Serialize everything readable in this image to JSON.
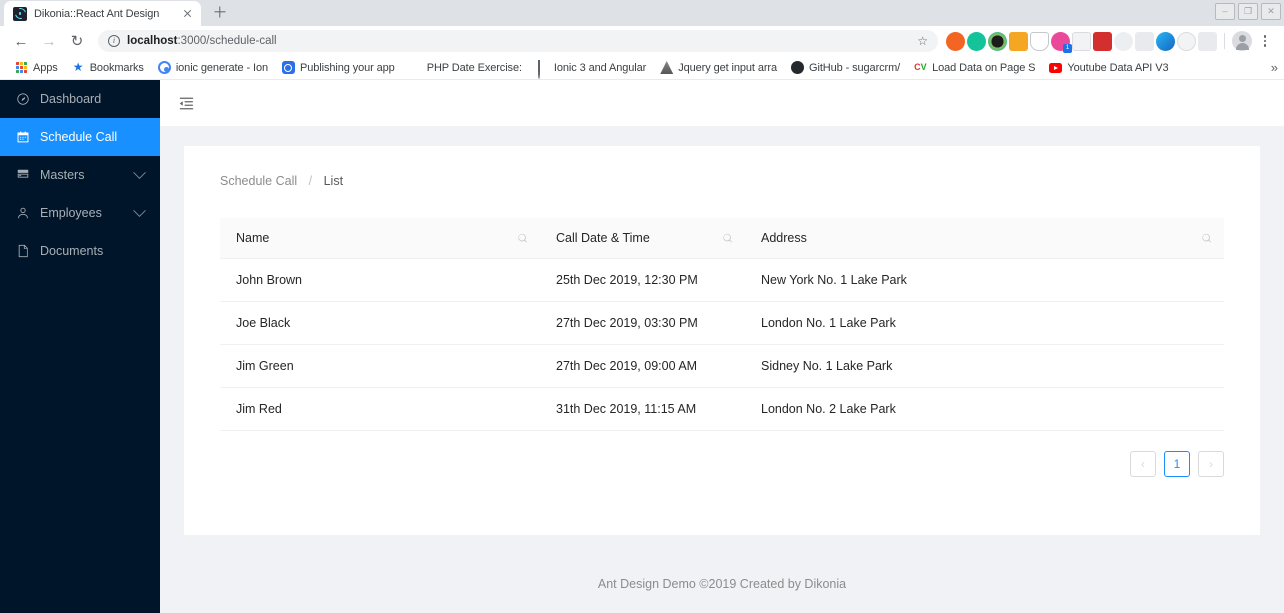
{
  "browser": {
    "tab": {
      "title": "Dikonia::React Ant Design",
      "favicon": "react-icon",
      "close": "×"
    },
    "new_tab_tooltip": "New tab",
    "window_controls": {
      "minimize": "–",
      "restore": "❐",
      "close": "✕"
    },
    "nav": {
      "back": "←",
      "forward": "→",
      "reload": "↻"
    },
    "omnibox": {
      "host": "localhost",
      "path": ":3000/schedule-call",
      "full_url": "localhost:3000/schedule-call",
      "info_icon": "i",
      "star_icon": "☆"
    },
    "extensions": [
      {
        "name": "extension-orange-icon",
        "color": "#f26522"
      },
      {
        "name": "grammarly-icon",
        "color": "#15c39a"
      },
      {
        "name": "extension-dark-circle-icon",
        "color": "#2b2b2b"
      },
      {
        "name": "extension-orange-square-icon",
        "color": "#f5a623"
      },
      {
        "name": "shield-icon",
        "color": "#ffffff"
      },
      {
        "name": "extension-pink-icon",
        "color": "#ec4899",
        "badge": "1"
      },
      {
        "name": "camera-icon",
        "color": "#f2f2f2"
      },
      {
        "name": "extension-red-icon",
        "color": "#d32f2f"
      },
      {
        "name": "extension-gray-circle-icon",
        "color": "#e0e0e0"
      },
      {
        "name": "google-g-icon",
        "color": "#e8e8e8"
      },
      {
        "name": "eyedropper-icon",
        "color": "#29b6f6"
      },
      {
        "name": "clock-icon",
        "color": "#e8e8e8"
      },
      {
        "name": "extension-train-icon",
        "color": "#dadce0"
      }
    ],
    "profile_icon": "avatar-icon",
    "menu_icon": "kebab-menu-icon",
    "bookmarks": [
      {
        "label": "Apps",
        "icon": "apps-grid-icon"
      },
      {
        "label": "Bookmarks",
        "icon": "star-icon"
      },
      {
        "label": "ionic generate - Ion",
        "icon": "ionic-icon"
      },
      {
        "label": "Publishing your app",
        "icon": "ionic-square-icon"
      },
      {
        "label": "PHP Date Exercise:",
        "icon": "php-icon"
      },
      {
        "label": "Ionic 3 and Angular",
        "icon": "drop-icon"
      },
      {
        "label": "Jquery get input arra",
        "icon": "jquery-icon"
      },
      {
        "label": "GitHub - sugarcrm/",
        "icon": "github-icon"
      },
      {
        "label": "Load Data on Page S",
        "icon": "cv-icon"
      },
      {
        "label": "Youtube Data API V3",
        "icon": "youtube-icon"
      }
    ],
    "bookmarks_overflow": "»"
  },
  "sidebar": {
    "items": [
      {
        "label": "Dashboard",
        "icon": "dashboard-icon",
        "active": false,
        "expandable": false
      },
      {
        "label": "Schedule Call",
        "icon": "calendar-icon",
        "active": true,
        "expandable": false
      },
      {
        "label": "Masters",
        "icon": "database-icon",
        "active": false,
        "expandable": true
      },
      {
        "label": "Employees",
        "icon": "user-icon",
        "active": false,
        "expandable": true
      },
      {
        "label": "Documents",
        "icon": "file-icon",
        "active": false,
        "expandable": false
      }
    ]
  },
  "header": {
    "fold_icon": "menu-fold-icon"
  },
  "breadcrumb": {
    "parent": "Schedule Call",
    "separator": "/",
    "current": "List"
  },
  "table": {
    "columns": [
      {
        "key": "name",
        "label": "Name",
        "search_icon": "search-icon"
      },
      {
        "key": "date",
        "label": "Call Date & Time",
        "search_icon": "search-icon"
      },
      {
        "key": "address",
        "label": "Address",
        "search_icon": "search-icon"
      }
    ],
    "rows": [
      {
        "name": "John Brown",
        "date": "25th Dec 2019, 12:30 PM",
        "address": "New York No. 1 Lake Park"
      },
      {
        "name": "Joe Black",
        "date": "27th Dec 2019, 03:30 PM",
        "address": "London No. 1 Lake Park"
      },
      {
        "name": "Jim Green",
        "date": "27th Dec 2019, 09:00 AM",
        "address": "Sidney No. 1 Lake Park"
      },
      {
        "name": "Jim Red",
        "date": "31th Dec 2019, 11:15 AM",
        "address": "London No. 2 Lake Park"
      }
    ]
  },
  "pagination": {
    "prev": "‹",
    "pages": [
      "1"
    ],
    "next": "›",
    "current": "1"
  },
  "footer": {
    "text": "Ant Design Demo ©2019 Created by Dikonia"
  },
  "colors": {
    "sidebar_bg": "#001529",
    "accent": "#1890ff",
    "content_bg": "#f0f2f5",
    "card_bg": "#ffffff",
    "table_header_bg": "#fafafa"
  }
}
